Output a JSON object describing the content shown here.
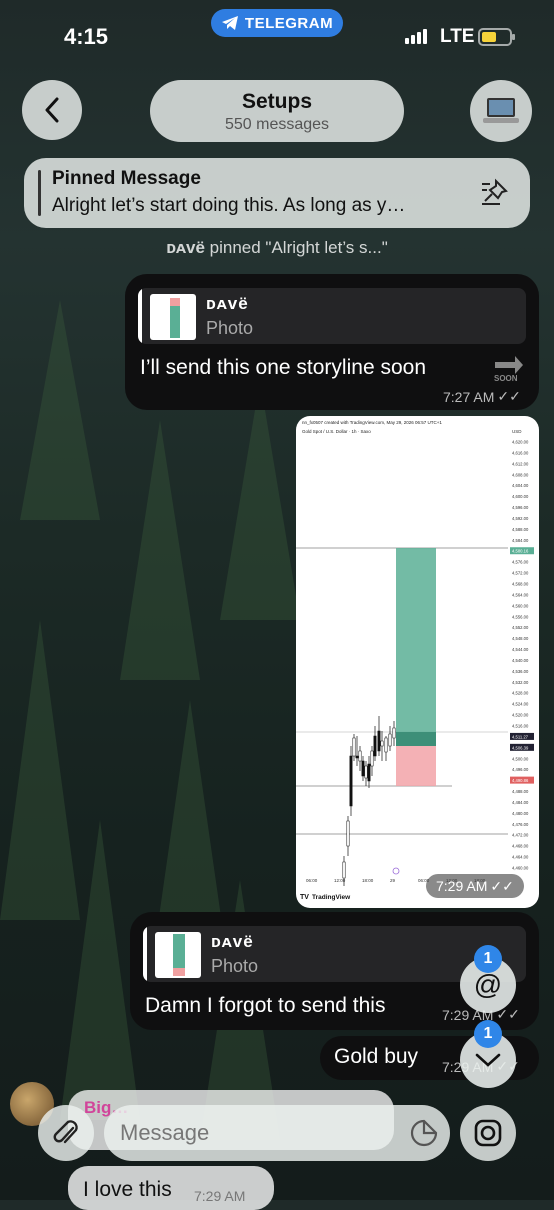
{
  "status_bar": {
    "time": "4:15",
    "app_pill": "TELEGRAM",
    "network": "LTE"
  },
  "header": {
    "title": "Setups",
    "subtitle": "550 messages",
    "avatar_icon": "laptop-icon"
  },
  "pinned": {
    "label": "Pinned Message",
    "text": "Alright let’s start doing this. As long as y…"
  },
  "service_message": {
    "sender": "ᴅᴀᴠë",
    "text": " pinned \"Alright let’s s...\""
  },
  "messages": [
    {
      "reply_name": "ᴅᴀᴠë",
      "reply_label": "Photo",
      "text": "I’ll send this one storyline soon",
      "time": "7:27 AM"
    },
    {
      "type": "photo",
      "time": "7:29 AM",
      "caption": "Gold Spot / U.S. Dollar · 1h · Saxo",
      "watermark": "TradingView",
      "header": "nn_fx0507 created with TradingView.com, May 29, 2026 06:57 UTC+1"
    },
    {
      "reply_name": "ᴅᴀᴠë",
      "reply_label": "Photo",
      "text": "Damn I forgot to send this",
      "time": "7:29 AM"
    },
    {
      "text": "Gold buy",
      "time": "7:29 AM"
    }
  ],
  "incoming": {
    "sender": "Big…",
    "text": "I love this",
    "time": "7:29 AM"
  },
  "fabs": {
    "mentions_badge": "1",
    "down_badge": "1"
  },
  "input": {
    "placeholder": "Message"
  },
  "chart_axis": {
    "price_ticks": [
      "4,620.00",
      "4,616.00",
      "4,612.00",
      "4,608.00",
      "4,604.00",
      "4,600.00",
      "4,596.00",
      "4,592.00",
      "4,588.00",
      "4,584.00",
      "4,580.16",
      "4,576.00",
      "4,572.00",
      "4,568.00",
      "4,564.00",
      "4,560.00",
      "4,556.00",
      "4,552.00",
      "4,548.00",
      "4,544.00",
      "4,540.00",
      "4,536.00",
      "4,532.00",
      "4,528.00",
      "4,524.00",
      "4,520.00",
      "4,516.00",
      "4,511.27",
      "4,506.39",
      "4,500.00",
      "4,496.00",
      "4,490.86",
      "4,488.00",
      "4,484.00",
      "4,480.00",
      "4,476.00",
      "4,472.00",
      "4,468.00",
      "4,464.00",
      "4,460.00"
    ],
    "time_ticks": [
      "06:00",
      "12:00",
      "18:00",
      "29",
      "06:00",
      "12:00",
      "18:00"
    ],
    "currency": "USD"
  }
}
